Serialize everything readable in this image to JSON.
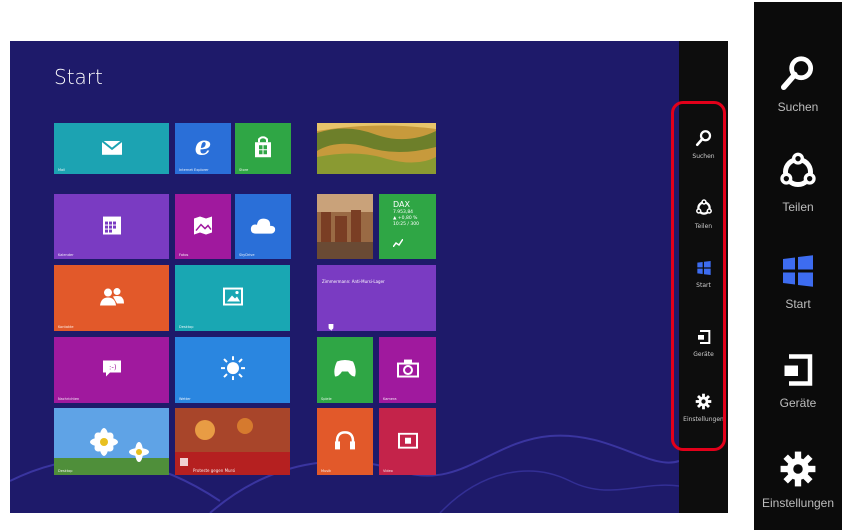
{
  "screen": {
    "title": "Start",
    "colors": {
      "background": "#1e1a6a",
      "charm_bar": "#0d0d0d",
      "highlight": "#e2001a",
      "start_icon": "#3d6cf0"
    }
  },
  "tiles": [
    {
      "name": "mail",
      "label": "Mail",
      "color": "#1ca3b2",
      "icon": "mail-icon"
    },
    {
      "name": "internet-explorer",
      "label": "Internet Explorer",
      "color": "#2a6fd8",
      "icon": "internet-explorer-icon"
    },
    {
      "name": "store",
      "label": "Store",
      "color": "#2fa645",
      "icon": "store-icon"
    },
    {
      "name": "calendar",
      "label": "Kalender",
      "color": "#7a3bc2",
      "icon": "calendar-icon"
    },
    {
      "name": "photos",
      "label": "Fotos",
      "color": "#a0199e",
      "icon": "photos-icon"
    },
    {
      "name": "skydrive",
      "label": "SkyDrive",
      "color": "#2a6fd8",
      "icon": "cloud-icon"
    },
    {
      "name": "people",
      "label": "Kontakte",
      "color": "#e2592a",
      "icon": "people-icon"
    },
    {
      "name": "desktop",
      "label": "Desktop",
      "color": "#19a7b3",
      "icon": "picture-icon"
    },
    {
      "name": "messaging",
      "label": "Nachrichten",
      "color": "#a0199e",
      "icon": "messaging-icon"
    },
    {
      "name": "weather",
      "label": "Wetter",
      "color": "#2a86e0",
      "icon": "sun-icon"
    },
    {
      "name": "daisies",
      "label": "Desktop",
      "color": "#4a8fd6",
      "icon": "flower-photo"
    },
    {
      "name": "news",
      "label": "Proteste gegen Mursi",
      "color": "#8a1c1c",
      "icon": "news-photo"
    },
    {
      "name": "travel",
      "label": "",
      "color": "#b58a2c",
      "icon": "landscape-photo"
    },
    {
      "name": "city",
      "label": "",
      "color": "#8c5a3a",
      "icon": "city-photo"
    },
    {
      "name": "finance",
      "label": "DAX",
      "color": "#2fa645",
      "icon": "chart-icon"
    },
    {
      "name": "sports",
      "label": "Zimmermann: Anti-Mursi-Lager",
      "color": "#7a3bc2",
      "icon": "trophy-icon"
    },
    {
      "name": "games",
      "label": "Spiele",
      "color": "#2fa645",
      "icon": "xbox-icon"
    },
    {
      "name": "camera",
      "label": "Kamera",
      "color": "#a0199e",
      "icon": "camera-icon"
    },
    {
      "name": "music",
      "label": "Musik",
      "color": "#e2592a",
      "icon": "headphones-icon"
    },
    {
      "name": "video",
      "label": "Video",
      "color": "#c4234a",
      "icon": "video-icon"
    }
  ],
  "finance_tile": {
    "title": "DAX",
    "values": [
      "7.953,84",
      "▲ +0,80 %",
      "10:25 / 300"
    ]
  },
  "charms": [
    {
      "name": "search",
      "label": "Suchen",
      "icon": "search-icon"
    },
    {
      "name": "share",
      "label": "Teilen",
      "icon": "share-icon"
    },
    {
      "name": "start",
      "label": "Start",
      "icon": "windows-icon"
    },
    {
      "name": "devices",
      "label": "Geräte",
      "icon": "devices-icon"
    },
    {
      "name": "settings",
      "label": "Einstellungen",
      "icon": "gear-icon"
    }
  ]
}
